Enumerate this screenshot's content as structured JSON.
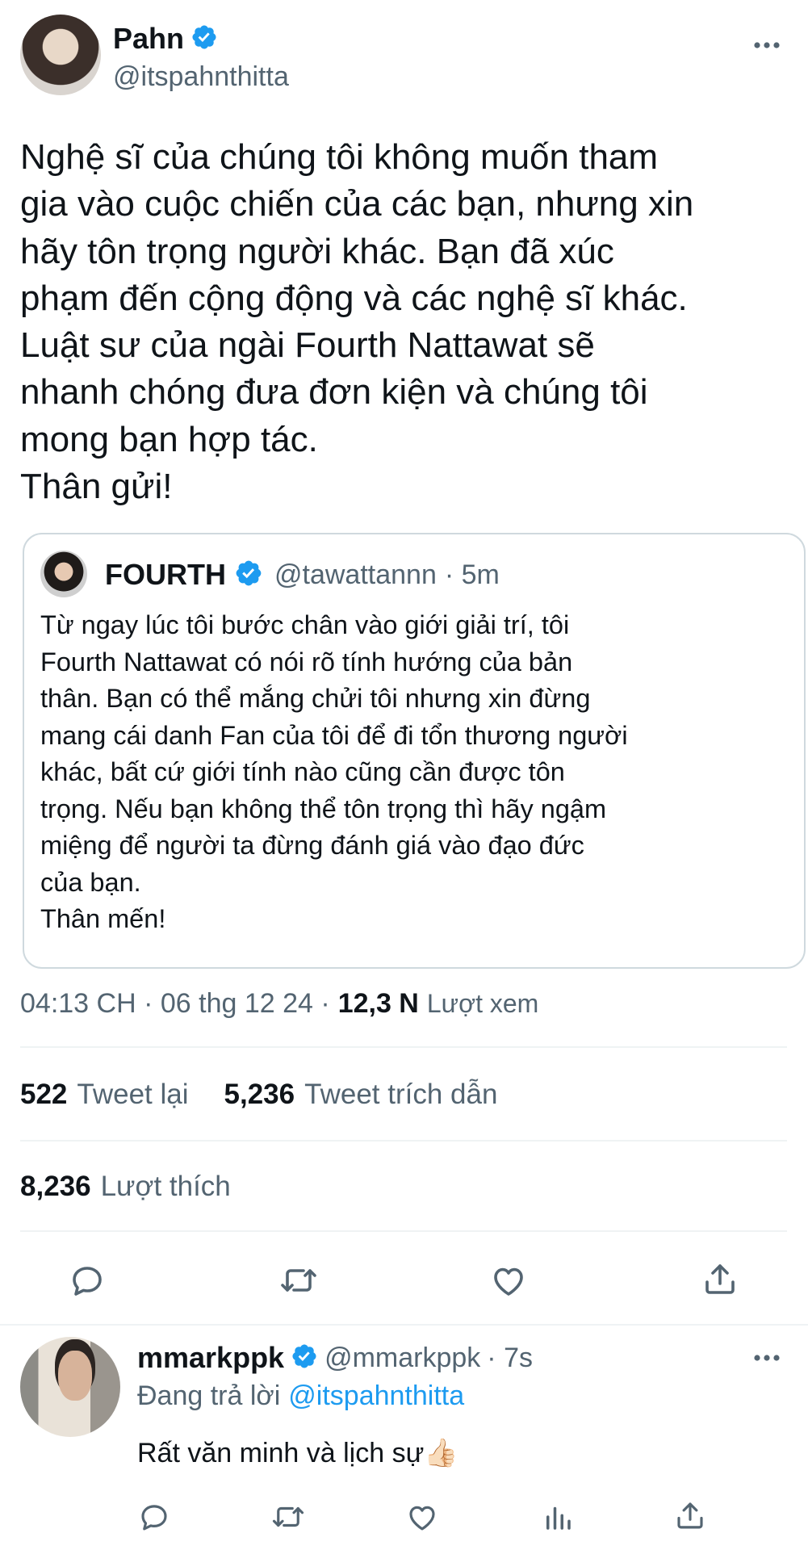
{
  "tweet": {
    "author_name": "Pahn",
    "author_handle": "@itspahnthitta",
    "more_icon": "more-horizontal-icon",
    "text": "Nghệ sĩ của chúng tôi không muốn tham\ngia vào cuộc chiến của các bạn, nhưng xin\nhãy tôn trọng người khác. Bạn đã xúc\nphạm đến cộng động và các nghệ sĩ khác.\nLuật sư của ngài Fourth Nattawat sẽ\nnhanh chóng đưa đơn kiện và chúng tôi\nmong bạn hợp tác.\nThân gửi!",
    "quote": {
      "author_name": "FOURTH",
      "author_handle": "@tawattannn",
      "time": "· 5m",
      "text": "Từ ngay lúc tôi bước chân vào giới giải trí, tôi\nFourth Nattawat có nói rõ tính hướng của bản\nthân. Bạn có thể mắng chửi tôi nhưng xin đừng\nmang cái danh Fan của tôi để đi tổn thương người\nkhác, bất cứ giới tính nào cũng cần được tôn\ntrọng. Nếu bạn không thể tôn trọng thì hãy ngậm\nmiệng để người ta đừng đánh giá vào đạo đức\ncủa bạn.\nThân mến!"
    },
    "timestamp": "04:13 CH · 06 thg 12 24 ·",
    "views_count": "12,3 N",
    "views_label": "Lượt xem",
    "retweets_count": "522",
    "retweets_label": "Tweet lại",
    "quotes_count": "5,236",
    "quotes_label": "Tweet trích dẫn",
    "likes_count": "8,236",
    "likes_label": "Lượt thích",
    "actions": [
      "reply-icon",
      "retweet-icon",
      "like-icon",
      "share-icon"
    ]
  },
  "reply": {
    "author_name": "mmarkppk",
    "author_handle": "@mmarkppk",
    "time": "· 7s",
    "replying_prefix": "Đang trả lời",
    "replying_to": "@itspahnthitta",
    "text": "Rất văn minh và lịch sự",
    "emoji": "👍🏻",
    "actions": [
      "reply-icon",
      "retweet-icon",
      "like-icon",
      "analytics-icon",
      "share-icon"
    ]
  },
  "colors": {
    "accent": "#1d9bf0",
    "text": "#0f1419",
    "secondary": "#536471",
    "border": "#cfd9de"
  }
}
